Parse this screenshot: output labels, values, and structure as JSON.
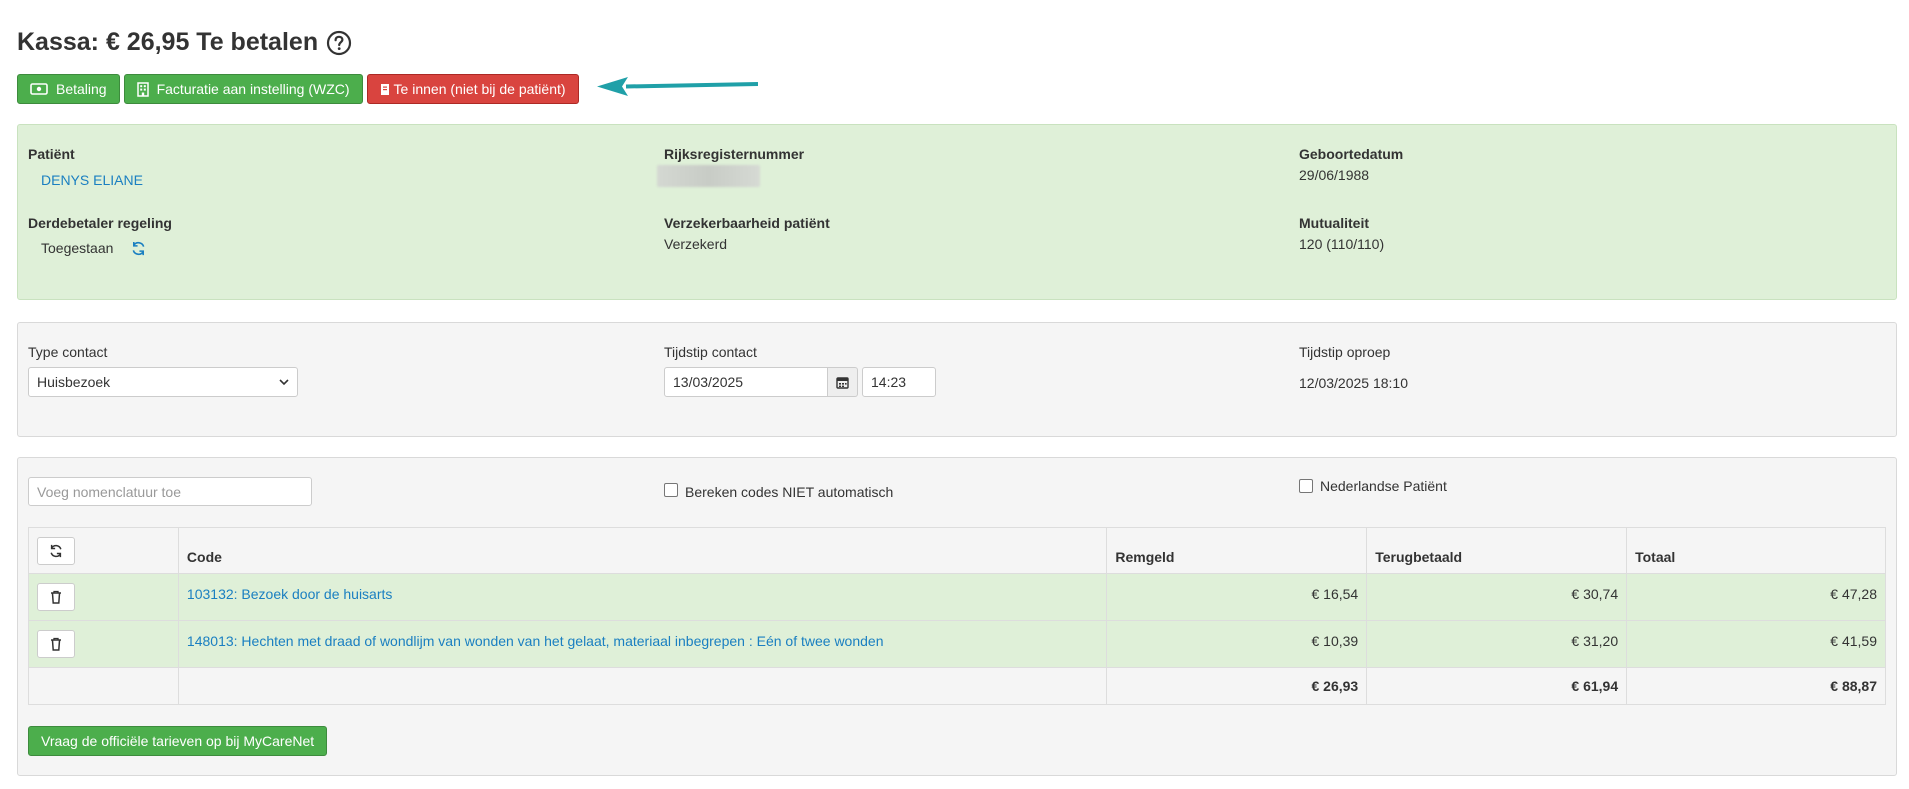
{
  "header": {
    "title": "Kassa: € 26,95 Te betalen"
  },
  "actions": {
    "payment": "Betaling",
    "invoice_institution": "Facturatie aan instelling (WZC)",
    "to_collect": "Te innen (niet bij de patiënt)"
  },
  "patient": {
    "patient_label": "Patiënt",
    "patient_name": "DENYS ELIANE",
    "rrn_label": "Rijksregisternummer",
    "birth_label": "Geboortedatum",
    "birth_value": "29/06/1988",
    "third_party_label": "Derdebetaler regeling",
    "third_party_value": "Toegestaan",
    "insurability_label": "Verzekerbaarheid patiënt",
    "insurability_value": "Verzekerd",
    "mutuality_label": "Mutualiteit",
    "mutuality_value": "120 (110/110)"
  },
  "contact": {
    "type_label": "Type contact",
    "type_value": "Huisbezoek",
    "time_label": "Tijdstip contact",
    "date_value": "13/03/2025",
    "time_value": "14:23",
    "call_label": "Tijdstip oproep",
    "call_value": "12/03/2025 18:10"
  },
  "codes": {
    "nomenclature_placeholder": "Voeg nomenclatuur toe",
    "auto_calc_label": "Bereken codes NIET automatisch",
    "dutch_patient_label": "Nederlandse Patiënt",
    "columns": {
      "code": "Code",
      "remgeld": "Remgeld",
      "terugbetaald": "Terugbetaald",
      "totaal": "Totaal"
    },
    "rows": [
      {
        "code": "103132: Bezoek door de huisarts",
        "remgeld": "€ 16,54",
        "terugbetaald": "€ 30,74",
        "totaal": "€ 47,28"
      },
      {
        "code": "148013: Hechten met draad of wondlijm van wonden van het gelaat, materiaal inbegrepen : Eén of twee wonden",
        "remgeld": "€ 10,39",
        "terugbetaald": "€ 31,20",
        "totaal": "€ 41,59"
      }
    ],
    "totals": {
      "remgeld": "€ 26,93",
      "terugbetaald": "€ 61,94",
      "totaal": "€ 88,87"
    },
    "mycarenet_button": "Vraag de officiële tarieven op bij MyCareNet"
  },
  "colors": {
    "green_button": "#4cae4c",
    "red_button": "#d9443f",
    "link": "#1a7fc1",
    "arrow": "#20a0a8",
    "green_panel": "#dff0d8"
  },
  "icons": [
    "help-circle-icon",
    "money-icon",
    "building-icon",
    "document-icon",
    "refresh-icon",
    "calendar-icon",
    "chevron-down-icon",
    "trash-icon",
    "arrow-left-icon"
  ]
}
